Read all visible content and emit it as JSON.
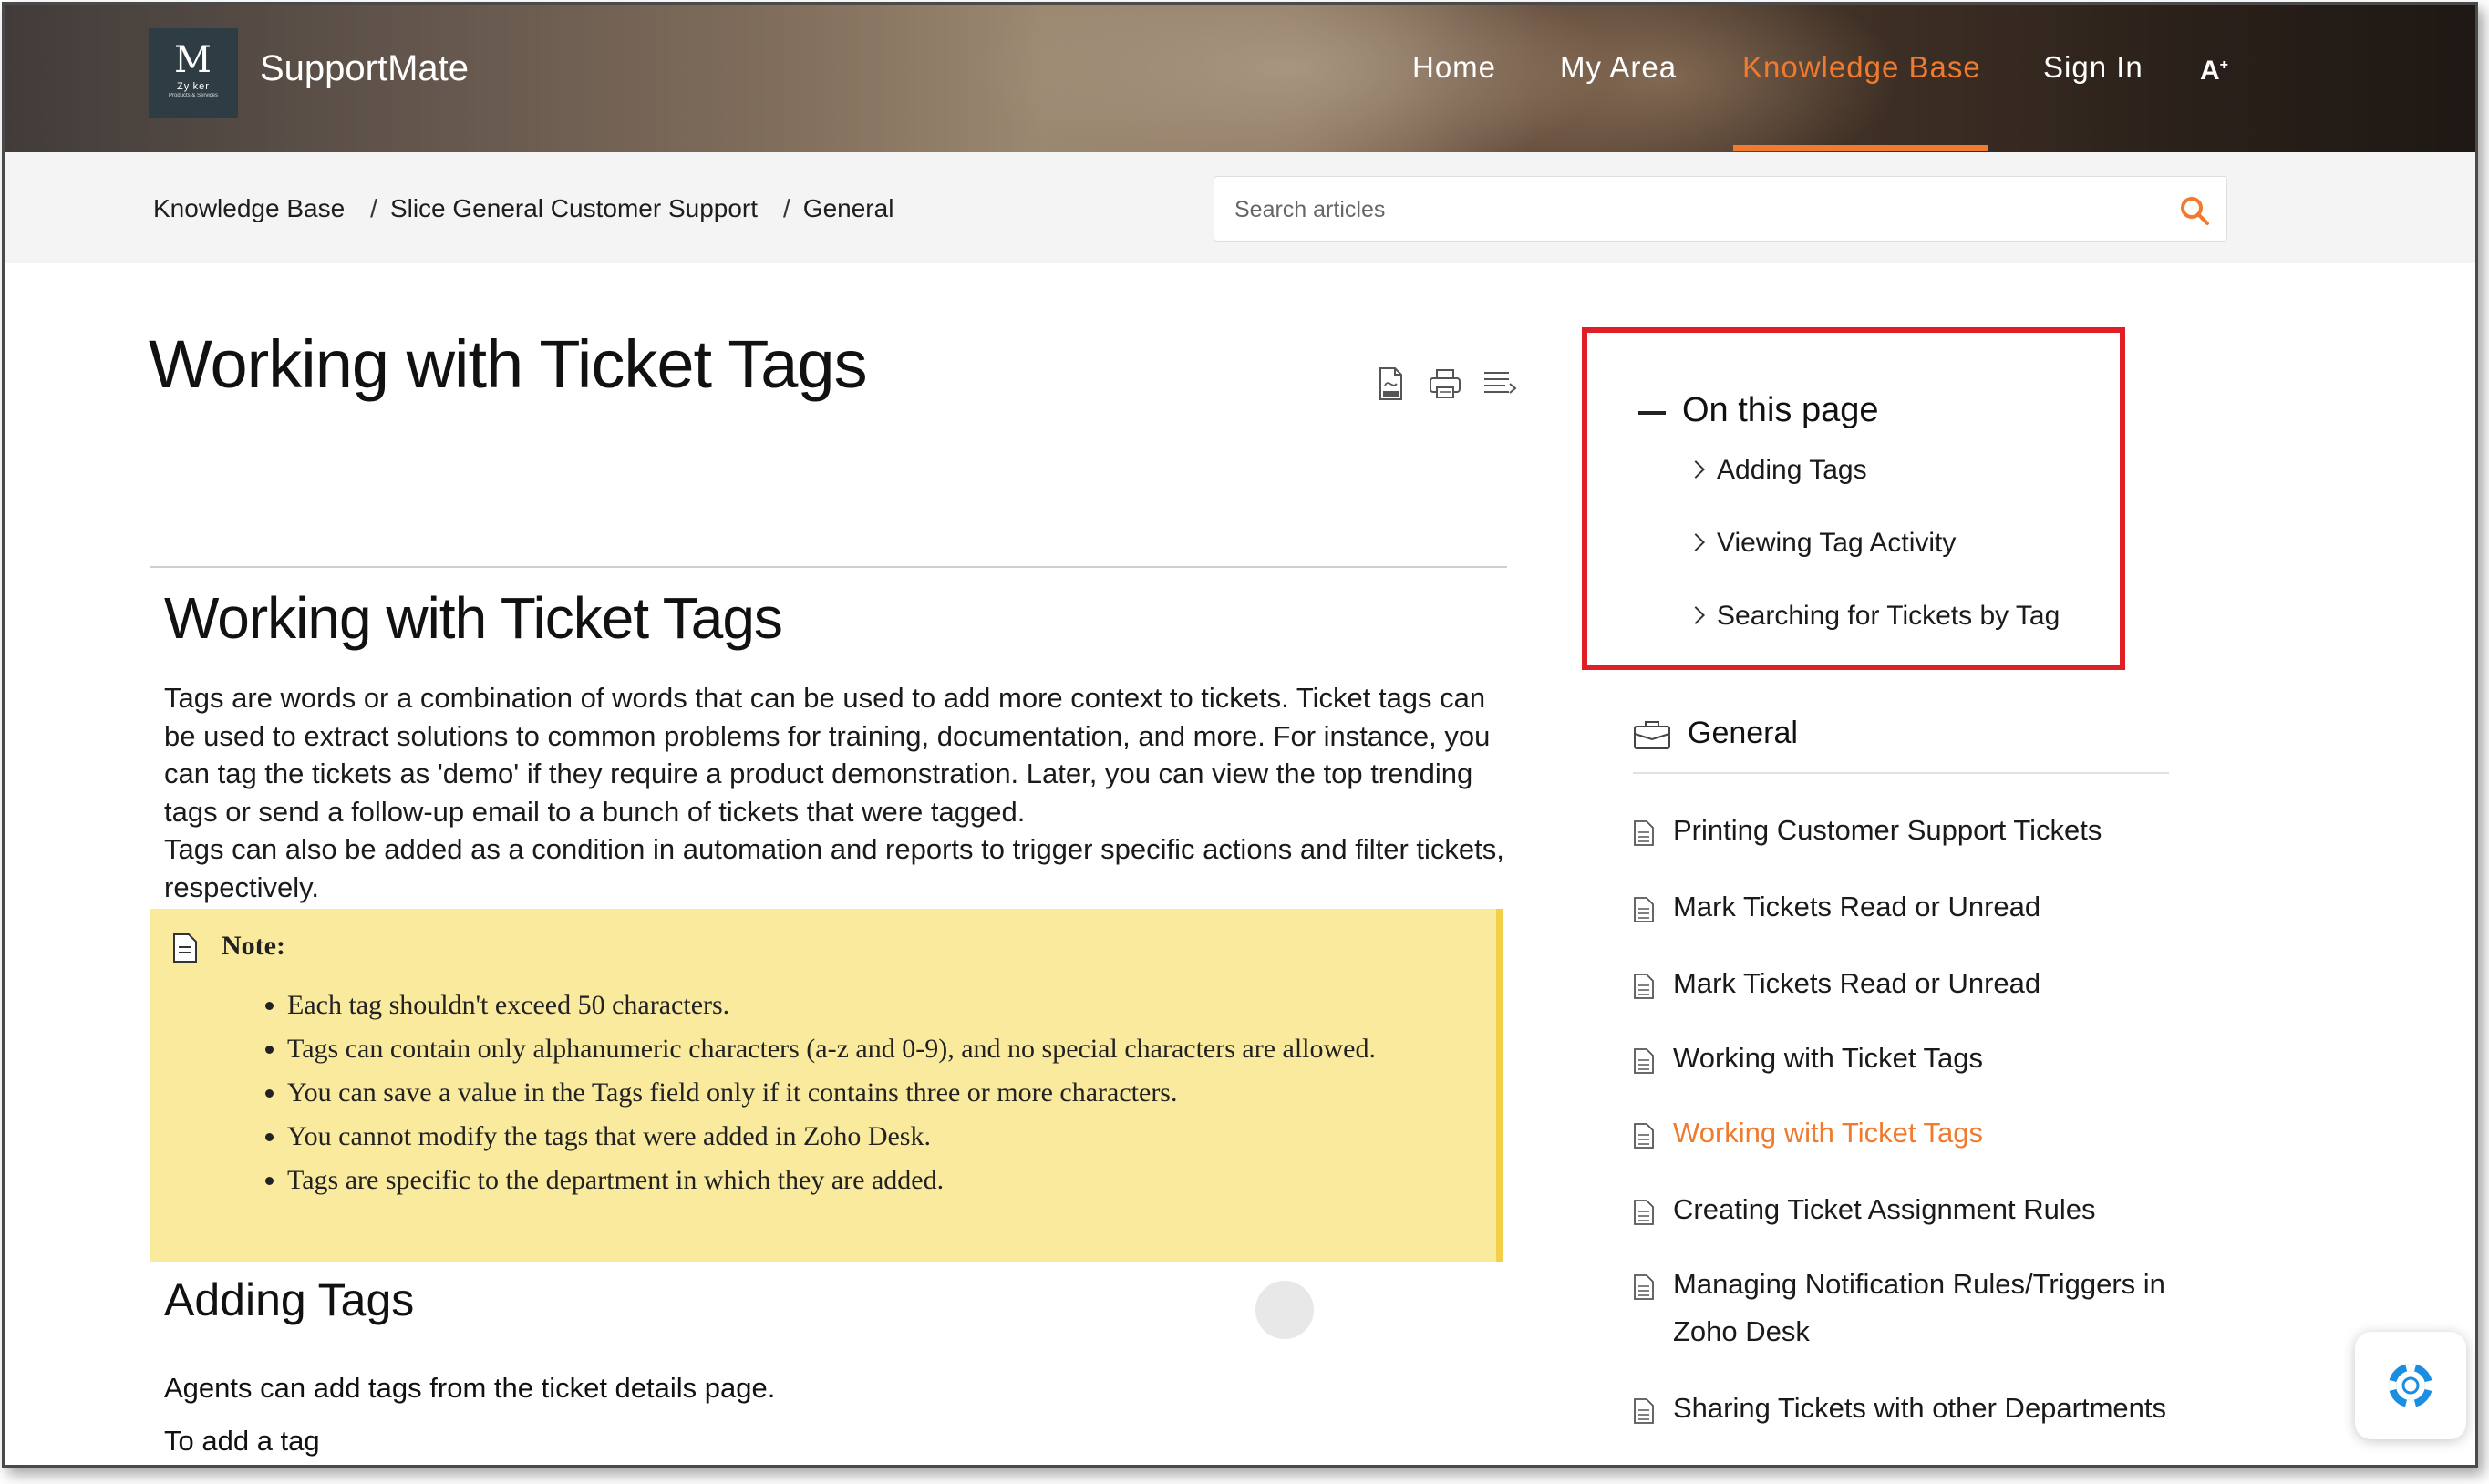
{
  "header": {
    "logo": {
      "monogram": "M",
      "company": "Zylker",
      "tagline": "Products & Services"
    },
    "brand_name": "SupportMate",
    "nav": [
      {
        "label": "Home",
        "active": false
      },
      {
        "label": "My Area",
        "active": false
      },
      {
        "label": "Knowledge Base",
        "active": true
      },
      {
        "label": "Sign In",
        "active": false
      }
    ],
    "accessibility_label": "A",
    "accessibility_sup": "+",
    "accent_color": "#f07a2e"
  },
  "breadcrumb": [
    "Knowledge Base",
    "Slice General Customer Support",
    "General"
  ],
  "breadcrumb_separator": "/",
  "search": {
    "placeholder": "Search articles",
    "value": ""
  },
  "article": {
    "title": "Working with Ticket Tags",
    "tools": [
      "pdf-icon",
      "print-icon",
      "reading-list-icon"
    ],
    "heading": "Working with Ticket Tags",
    "intro": "Tags are words or a combination of words that can be used to add more context to tickets. Ticket tags can be used to extract solutions to common problems for training, documentation, and more. For instance, you can tag the tickets as 'demo' if they require a product demonstration. Later, you can view the top trending tags or send a follow-up email to a bunch of tickets that were tagged.",
    "intro2": "Tags can also be added as a condition in automation and reports to trigger specific actions and filter tickets, respectively.",
    "note": {
      "label": "Note:",
      "items": [
        "Each tag shouldn't  exceed 50 characters.",
        "Tags can contain  only  alphanumeric  characters (a-z and 0-9), and no special  characters  are allowed.",
        "You can save a value  in the Tags field  only  if it contains  three  or more characters.",
        "You cannot  modify  the tags that were added in Zoho Desk.",
        "Tags are specific  to the department  in  which  they are added."
      ],
      "background": "#f9ea9e"
    },
    "section_heading": "Adding Tags",
    "section_text1": "Agents can add tags from the ticket details page.",
    "section_text2": "To add a tag"
  },
  "toc": {
    "title": "On this page",
    "items": [
      "Adding Tags",
      "Viewing Tag Activity",
      "Searching for Tickets by Tag"
    ],
    "highlight_color": "#e01e26"
  },
  "sidebar": {
    "category": "General",
    "items": [
      {
        "label": "Printing Customer Support Tickets",
        "active": false
      },
      {
        "label": "Mark Tickets Read or Unread",
        "active": false
      },
      {
        "label": "Mark Tickets Read or Unread",
        "active": false
      },
      {
        "label": "Working with Ticket Tags",
        "active": false
      },
      {
        "label": "Working with Ticket Tags",
        "active": true
      },
      {
        "label": "Creating Ticket Assignment Rules",
        "active": false
      },
      {
        "label": "Managing Notification Rules/Triggers in Zoho Desk",
        "active": false
      },
      {
        "label": "Sharing Tickets with other Departments",
        "active": false
      }
    ]
  },
  "help_widget": {
    "icon": "lifebuoy-icon"
  }
}
